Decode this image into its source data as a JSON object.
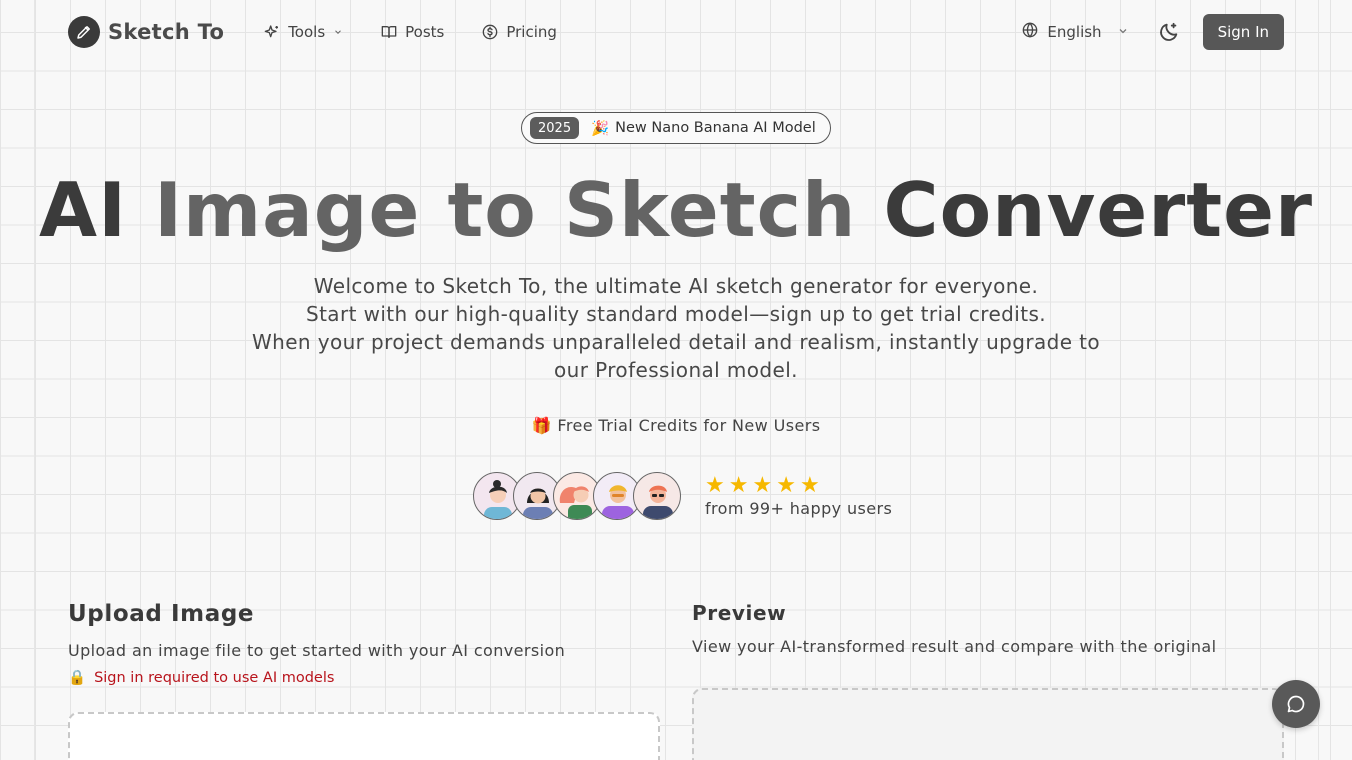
{
  "header": {
    "logo_text": "Sketch To",
    "nav": {
      "tools": "Tools",
      "posts": "Posts",
      "pricing": "Pricing"
    },
    "language": "English",
    "signin": "Sign In"
  },
  "hero": {
    "badge_year": "2025",
    "badge_emoji": "🎉",
    "badge_text": "New Nano Banana AI Model",
    "title": {
      "w1": "AI",
      "w2": "Image",
      "w3": "to",
      "w4": "Sketch",
      "w5": "Converter"
    },
    "description": {
      "line1": "Welcome to Sketch To, the ultimate AI sketch generator for everyone.",
      "line2": "Start with our high-quality standard model—sign up to get trial credits.",
      "line3": "When your project demands unparalleled detail and realism, instantly upgrade to",
      "line4": "our Professional model."
    },
    "credits_emoji": "🎁",
    "credits_text": "Free Trial Credits for New Users",
    "rating_text": "from 99+ happy users",
    "stars": 5
  },
  "upload": {
    "title": "Upload Image",
    "subtitle": "Upload an image file to get started with your AI conversion",
    "warning_emoji": "🔒",
    "warning": "Sign in required to use AI models"
  },
  "preview": {
    "title": "Preview",
    "subtitle": "View your AI-transformed result and compare with the original"
  },
  "colors": {
    "accent": "#575757",
    "star": "#f6b800",
    "warning": "#b8141c"
  }
}
